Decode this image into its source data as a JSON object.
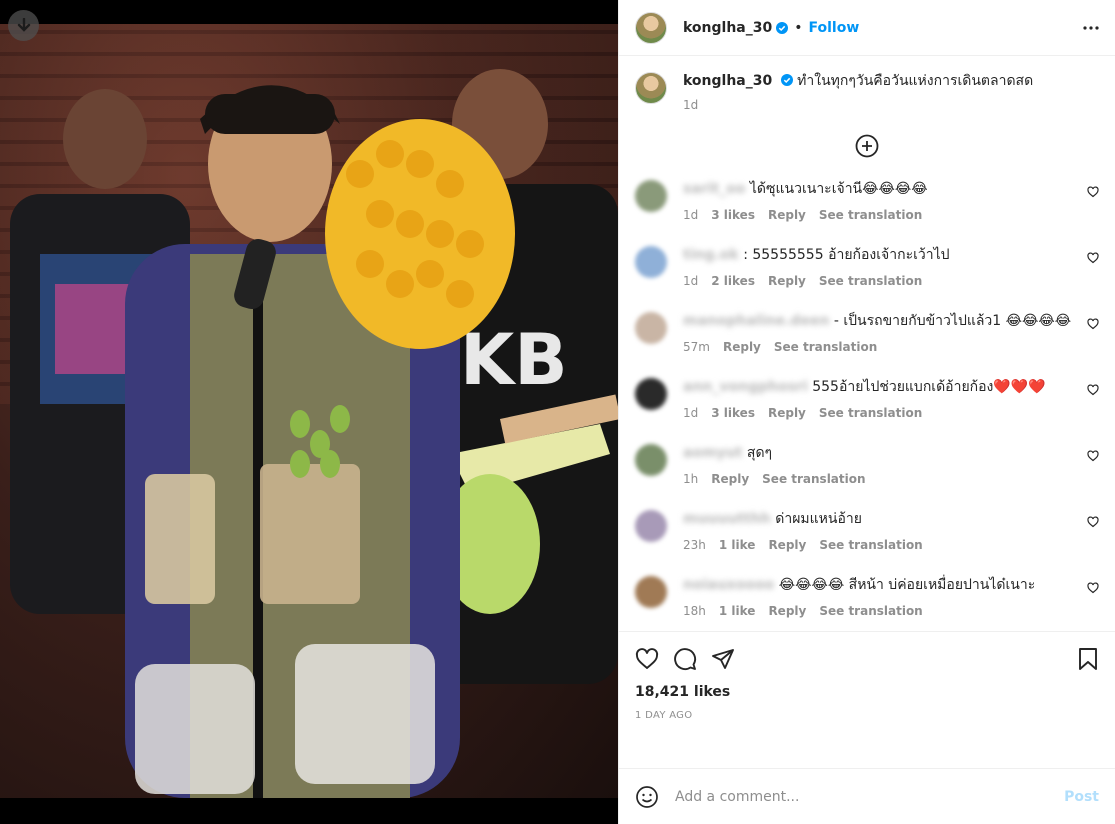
{
  "post": {
    "username": "konglha_30",
    "follow_label": "Follow",
    "separator": "•",
    "caption": "ทำในทุกๆวันคือวันแห่งการเดินตลาดสด",
    "caption_time": "1d",
    "likes": "18,421 likes",
    "posted_ago": "1 DAY AGO"
  },
  "comments": [
    {
      "user": "sarit_oo",
      "text": "ได้ซุแนวเนาะเจ้านี😂😂😂😂",
      "time": "1d",
      "likes": "3 likes",
      "avatar": "#8a9a7a"
    },
    {
      "user": "ting.ok",
      "text": ": 55555555 อ้ายก้องเจ้ากะเว้าไป",
      "time": "1d",
      "likes": "2 likes",
      "avatar": "#8fb0d8"
    },
    {
      "user": "manophaline.deen",
      "text": "- เป็นรถขายกับข้าวไปแล้ว1 😂😂😂😂",
      "time": "57m",
      "likes": "",
      "avatar": "#c9b5a5"
    },
    {
      "user": "ann_vongphosri",
      "text": "555อ้ายไปช่วยแบกเด้อ้ายก้อง❤️❤️❤️",
      "time": "1d",
      "likes": "3 likes",
      "avatar": "#2a2a2a"
    },
    {
      "user": "aomyut",
      "text": "สุดๆ",
      "time": "1h",
      "likes": "",
      "avatar": "#7a8f6a"
    },
    {
      "user": "muuuutthh",
      "text": "ด่าผมแหน่อ้าย",
      "time": "23h",
      "likes": "1 like",
      "avatar": "#a89ab8"
    },
    {
      "user": "noiauxoooo",
      "text": "😂😂😂😂 สีหน้า บ่ค่อยเหมื่อยปานได๋เนาะ",
      "time": "18h",
      "likes": "1 like",
      "avatar": "#a07a55"
    }
  ],
  "labels": {
    "reply": "Reply",
    "see_translation": "See translation",
    "add_comment_placeholder": "Add a comment...",
    "post_button": "Post"
  },
  "colors": {
    "accent": "#0095f6",
    "post_disabled": "#b2dffc",
    "muted": "#8e8e8e"
  }
}
